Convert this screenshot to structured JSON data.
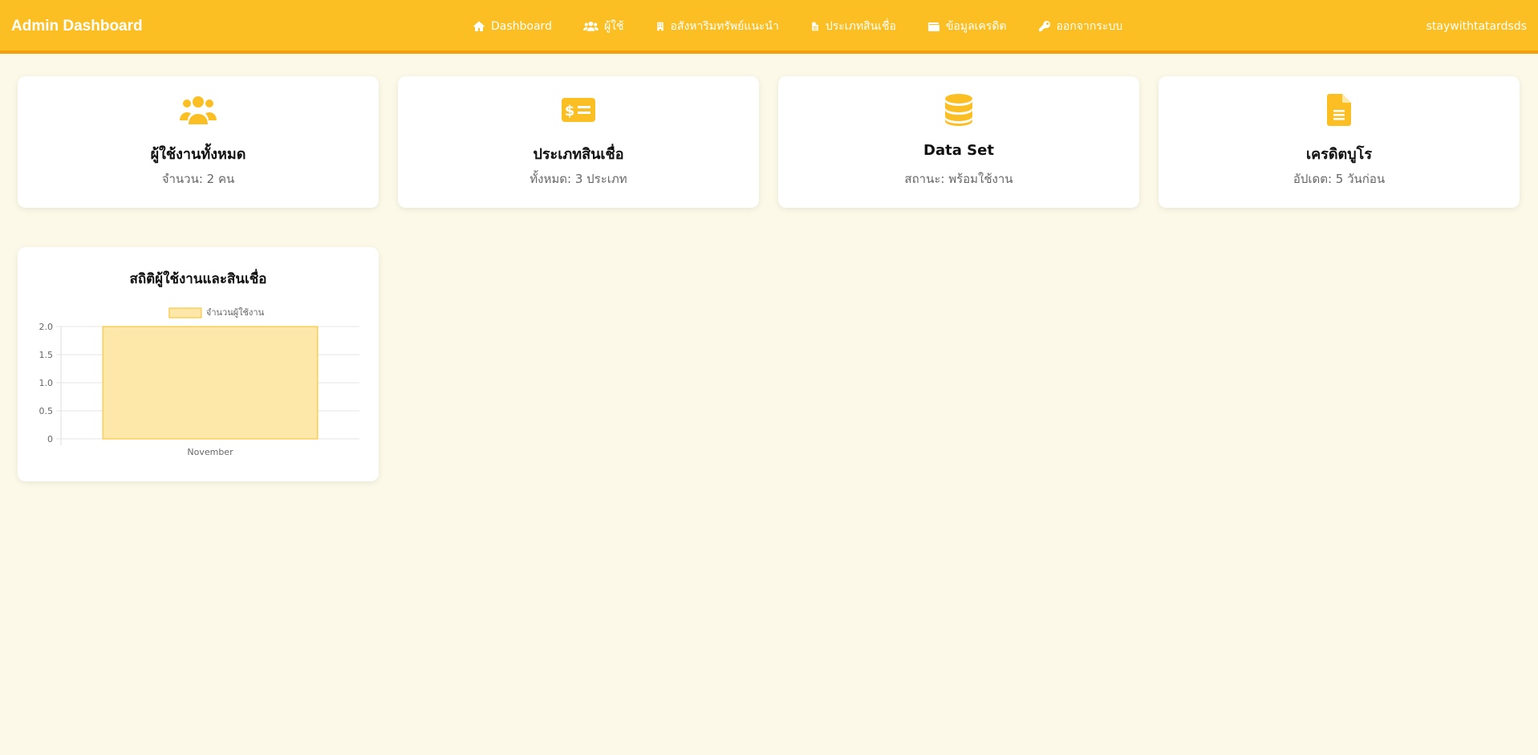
{
  "navbar": {
    "brand": "Admin Dashboard",
    "links": [
      {
        "label": "Dashboard",
        "icon": "home-icon"
      },
      {
        "label": "ผู้ใช้",
        "icon": "users-icon"
      },
      {
        "label": "อสังหาริมทรัพย์แนะนำ",
        "icon": "building-icon"
      },
      {
        "label": "ประเภทสินเชื่อ",
        "icon": "file-icon"
      },
      {
        "label": "ข้อมูลเครดิต",
        "icon": "wallet-icon"
      },
      {
        "label": "ออกจากระบบ",
        "icon": "key-icon"
      }
    ],
    "user": "staywithtatardsds"
  },
  "cards": [
    {
      "icon": "users-icon",
      "title": "ผู้ใช้งานทั้งหมด",
      "subtitle": "จำนวน: 2 คน"
    },
    {
      "icon": "money-check-icon",
      "title": "ประเภทสินเชื่อ",
      "subtitle": "ทั้งหมด: 3 ประเภท"
    },
    {
      "icon": "database-icon",
      "title": "Data Set",
      "subtitle": "สถานะ: พร้อมใช้งาน"
    },
    {
      "icon": "file-alt-icon",
      "title": "เครดิตบูโร",
      "subtitle": "อัปเดต: 5 วันก่อน"
    }
  ],
  "chart_card": {
    "title": "สถิติผู้ใช้งานและสินเชื่อ"
  },
  "chart_data": {
    "type": "bar",
    "categories": [
      "November"
    ],
    "series": [
      {
        "name": "จำนวนผู้ใช้งาน",
        "values": [
          2
        ]
      }
    ],
    "yticks": [
      "0",
      "0.5",
      "1.0",
      "1.5",
      "2.0"
    ],
    "ylim": [
      0,
      2
    ],
    "legend": "top",
    "grid": true,
    "colors": {
      "fill": "#fde7a9",
      "stroke": "#fbbf24"
    }
  },
  "theme": {
    "accent": "#fbbf24",
    "background": "#fdf9e8"
  }
}
